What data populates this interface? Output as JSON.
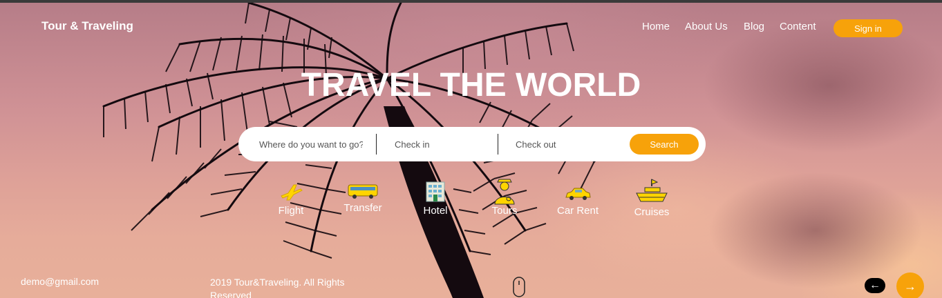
{
  "header": {
    "brand": "Tour & Traveling",
    "nav": [
      {
        "label": "Home"
      },
      {
        "label": "About Us"
      },
      {
        "label": "Blog"
      },
      {
        "label": "Content"
      }
    ],
    "signin_label": "Sign in"
  },
  "hero": {
    "headline": "TRAVEL THE WORLD"
  },
  "search": {
    "destination_placeholder": "Where do you want to go?",
    "checkin_placeholder": "Check in",
    "checkout_placeholder": "Check out",
    "button_label": "Search"
  },
  "categories": [
    {
      "label": "Flight",
      "icon": "airplane-icon"
    },
    {
      "label": "Transfer",
      "icon": "bus-icon"
    },
    {
      "label": "Hotel",
      "icon": "hotel-icon"
    },
    {
      "label": "Tours",
      "icon": "tour-guide-icon"
    },
    {
      "label": "Car Rent",
      "icon": "car-icon"
    },
    {
      "label": "Cruises",
      "icon": "ship-icon"
    }
  ],
  "footer": {
    "email": "demo@gmail.com",
    "copyright": "2019 Tour&Traveling. All Rights Reserved",
    "prev_icon": "arrow-left-icon",
    "next_icon": "arrow-right-icon"
  },
  "colors": {
    "accent": "#f7a20a",
    "text": "#ffffff"
  }
}
